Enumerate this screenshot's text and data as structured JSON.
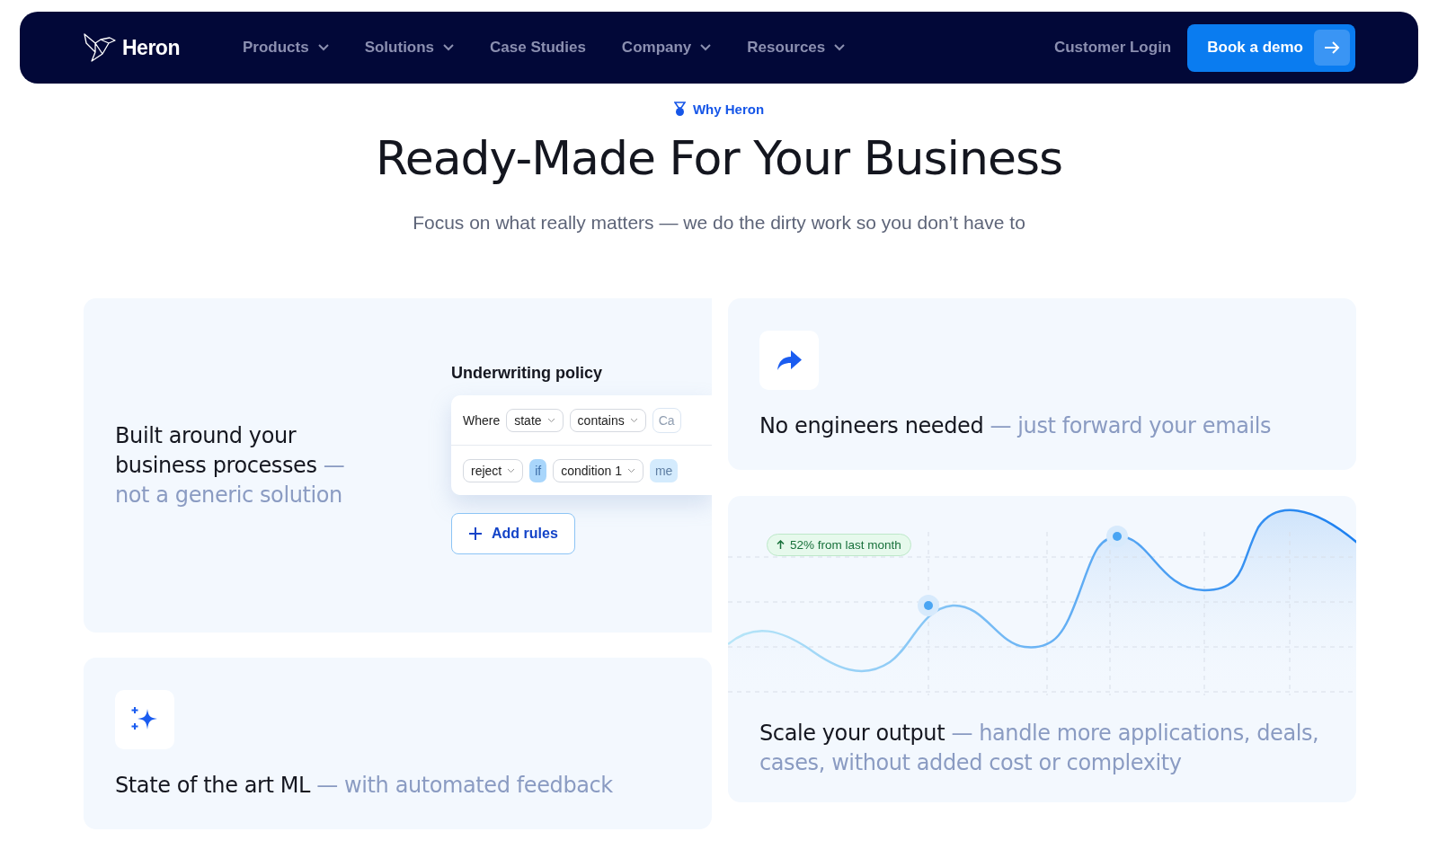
{
  "nav": {
    "brand": "Heron",
    "items": [
      {
        "label": "Products",
        "has_menu": true
      },
      {
        "label": "Solutions",
        "has_menu": true
      },
      {
        "label": "Case Studies",
        "has_menu": false
      },
      {
        "label": "Company",
        "has_menu": true
      },
      {
        "label": "Resources",
        "has_menu": true
      }
    ],
    "login": "Customer Login",
    "cta": "Book a demo"
  },
  "hero": {
    "eyebrow": "Why Heron",
    "title": "Ready-Made For Your Business",
    "subtitle": "Focus on what really matters — we do the dirty work so you don’t have to"
  },
  "cards": [
    {
      "kind": "policy",
      "lead": "Built around your business processes",
      "tail": "— not a generic solution",
      "policy": {
        "title": "Underwriting policy",
        "rows": [
          [
            {
              "kind": "text",
              "text": "Where"
            },
            {
              "kind": "select",
              "text": "state"
            },
            {
              "kind": "select",
              "text": "contains"
            },
            {
              "kind": "faded",
              "text": "Ca"
            }
          ],
          [
            {
              "kind": "select",
              "text": "reject"
            },
            {
              "kind": "tag",
              "text": "if"
            },
            {
              "kind": "select",
              "text": "condition 1"
            },
            {
              "kind": "fadedtag",
              "text": "me"
            }
          ]
        ],
        "add": "Add rules"
      }
    },
    {
      "kind": "sparkle",
      "lead": "State of the art ML",
      "tail": "— with automated feedback"
    },
    {
      "kind": "forward",
      "lead": "No engineers needed",
      "tail": "— just forward your emails"
    },
    {
      "kind": "chart",
      "lead": "Scale your output",
      "tail": "— handle more applications, deals, cases, without added cost or complexity",
      "badge": "52% from last month"
    }
  ]
}
